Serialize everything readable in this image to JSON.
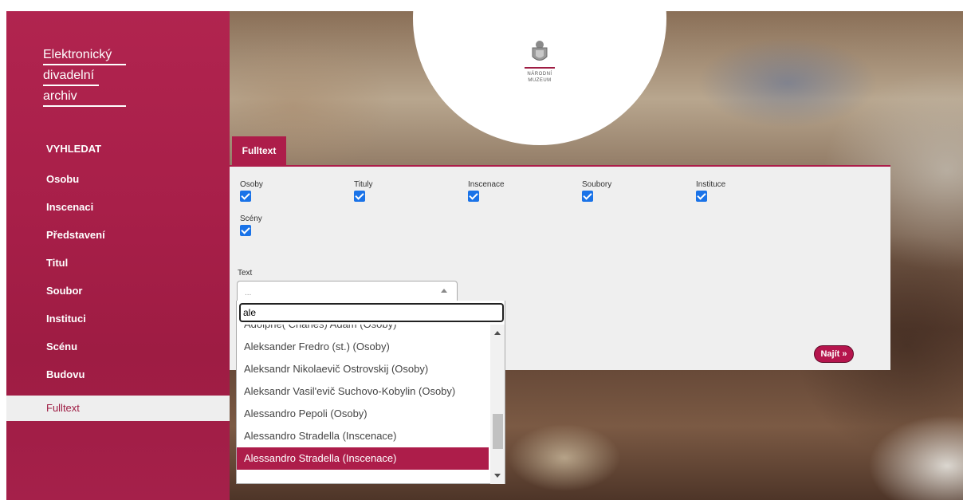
{
  "logo": {
    "lines": [
      "Elektronický",
      "divadelní",
      "archiv"
    ]
  },
  "nav": {
    "heading": "VYHLEDAT",
    "items": [
      {
        "label": "Osobu"
      },
      {
        "label": "Inscenaci"
      },
      {
        "label": "Představení"
      },
      {
        "label": "Titul"
      },
      {
        "label": "Soubor"
      },
      {
        "label": "Instituci"
      },
      {
        "label": "Scénu"
      },
      {
        "label": "Budovu"
      },
      {
        "label": "Fulltext",
        "active": true
      }
    ]
  },
  "museum": {
    "name_line1": "NÁRODNÍ",
    "name_line2": "MUZEUM"
  },
  "tab": {
    "label": "Fulltext"
  },
  "categories": [
    {
      "label": "Osoby",
      "checked": true
    },
    {
      "label": "Tituly",
      "checked": true
    },
    {
      "label": "Inscenace",
      "checked": true
    },
    {
      "label": "Soubory",
      "checked": true
    },
    {
      "label": "Instituce",
      "checked": true
    },
    {
      "label": "Scény",
      "checked": true
    }
  ],
  "text_field": {
    "label": "Text",
    "placeholder": "..."
  },
  "dropdown": {
    "search_value": "ale",
    "results": [
      {
        "label": "Adolphe( Charles) Adam (Osoby)"
      },
      {
        "label": "Aleksander Fredro (st.) (Osoby)"
      },
      {
        "label": "Aleksandr Nikolaevič Ostrovskij (Osoby)"
      },
      {
        "label": "Aleksandr Vasil'evič Suchovo-Kobylin (Osoby)"
      },
      {
        "label": "Alessandro Pepoli (Osoby)"
      },
      {
        "label": "Alessandro Stradella (Inscenace)"
      },
      {
        "label": "Alessandro Stradella (Inscenace)",
        "selected": true
      }
    ]
  },
  "find_button": {
    "label": "Najít »"
  },
  "colors": {
    "accent": "#ad1d4a",
    "checkbox": "#1a73e8",
    "panel": "#efefef"
  }
}
